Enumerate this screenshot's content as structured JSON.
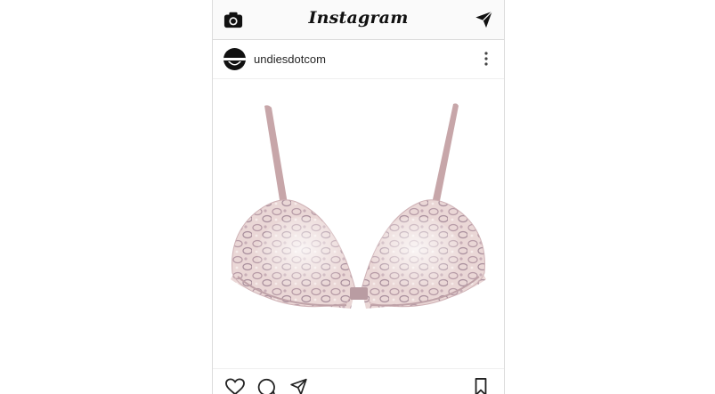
{
  "app": {
    "title": "Instagram"
  },
  "post": {
    "username": "undiesdotcom",
    "image_description": "pink snakeskin print push-up bra"
  },
  "icons": {
    "camera": "camera-icon",
    "direct": "paper-plane-icon",
    "more": "more-options-icon",
    "like": "heart-icon",
    "comment": "comment-icon",
    "share": "paper-plane-icon",
    "save": "bookmark-icon"
  },
  "colors": {
    "bar_background": "#fafafa",
    "text": "#262626",
    "border": "#dbdbdb"
  }
}
